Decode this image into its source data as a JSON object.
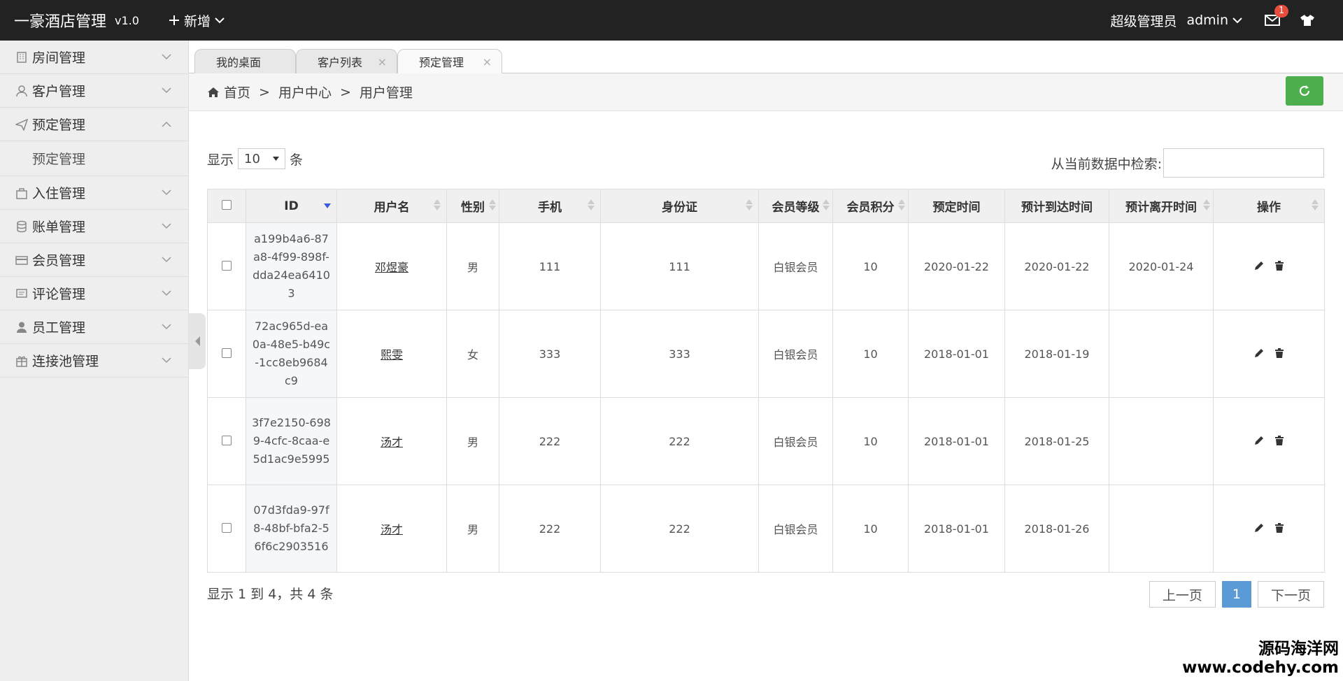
{
  "header": {
    "app_title": "一豪酒店管理",
    "version": "v1.0",
    "new_label": "新增",
    "user_role": "超级管理员",
    "username": "admin",
    "mail_count": "1"
  },
  "sidebar": {
    "items": [
      {
        "label": "房间管理",
        "icon": "building-icon"
      },
      {
        "label": "客户管理",
        "icon": "user-icon"
      },
      {
        "label": "预定管理",
        "icon": "send-icon",
        "expanded": true
      },
      {
        "label": "入住管理",
        "icon": "bag-icon"
      },
      {
        "label": "账单管理",
        "icon": "database-icon"
      },
      {
        "label": "会员管理",
        "icon": "card-icon"
      },
      {
        "label": "评论管理",
        "icon": "comment-icon"
      },
      {
        "label": "员工管理",
        "icon": "user-solid-icon"
      },
      {
        "label": "连接池管理",
        "icon": "gift-icon"
      }
    ],
    "sub_item": "预定管理"
  },
  "tabs": [
    {
      "label": "我的桌面",
      "closable": false
    },
    {
      "label": "客户列表",
      "closable": true
    },
    {
      "label": "预定管理",
      "closable": true,
      "active": true
    }
  ],
  "breadcrumb": {
    "home": "首页",
    "level1": "用户中心",
    "level2": "用户管理"
  },
  "controls": {
    "show_prefix": "显示",
    "page_size": "10",
    "show_suffix": "条",
    "search_label": "从当前数据中检索:",
    "search_value": ""
  },
  "table": {
    "headers": [
      "ID",
      "用户名",
      "性别",
      "手机",
      "身份证",
      "会员等级",
      "会员积分",
      "预定时间",
      "预计到达时间",
      "预计离开时间",
      "操作"
    ],
    "rows": [
      {
        "id": "a199b4a6-87a8-4f99-898f-dda24ea64103",
        "username": "邓煜豪",
        "gender": "男",
        "phone": "111",
        "idcard": "111",
        "level": "白银会员",
        "points": "10",
        "book_time": "2020-01-22",
        "arrive": "2020-01-22",
        "leave": "2020-01-24"
      },
      {
        "id": "72ac965d-ea0a-48e5-b49c-1cc8eb9684c9",
        "username": "熙雯",
        "gender": "女",
        "phone": "333",
        "idcard": "333",
        "level": "白银会员",
        "points": "10",
        "book_time": "2018-01-01",
        "arrive": "2018-01-19",
        "leave": ""
      },
      {
        "id": "3f7e2150-6989-4cfc-8caa-e5d1ac9e5995",
        "username": "汤才",
        "gender": "男",
        "phone": "222",
        "idcard": "222",
        "level": "白银会员",
        "points": "10",
        "book_time": "2018-01-01",
        "arrive": "2018-01-25",
        "leave": ""
      },
      {
        "id": "07d3fda9-97f8-48bf-bfa2-56f6c2903516",
        "username": "汤才",
        "gender": "男",
        "phone": "222",
        "idcard": "222",
        "level": "白银会员",
        "points": "10",
        "book_time": "2018-01-01",
        "arrive": "2018-01-26",
        "leave": ""
      }
    ]
  },
  "footer": {
    "info": "显示 1 到 4，共 4 条",
    "prev": "上一页",
    "current_page": "1",
    "next": "下一页"
  },
  "watermark": {
    "line1": "源码海洋网",
    "line2": "www.codehy.com"
  },
  "colors": {
    "topbar": "#222222",
    "refresh": "#4cae4c",
    "page_active": "#5b9bd5",
    "badge": "#e74c3c"
  }
}
